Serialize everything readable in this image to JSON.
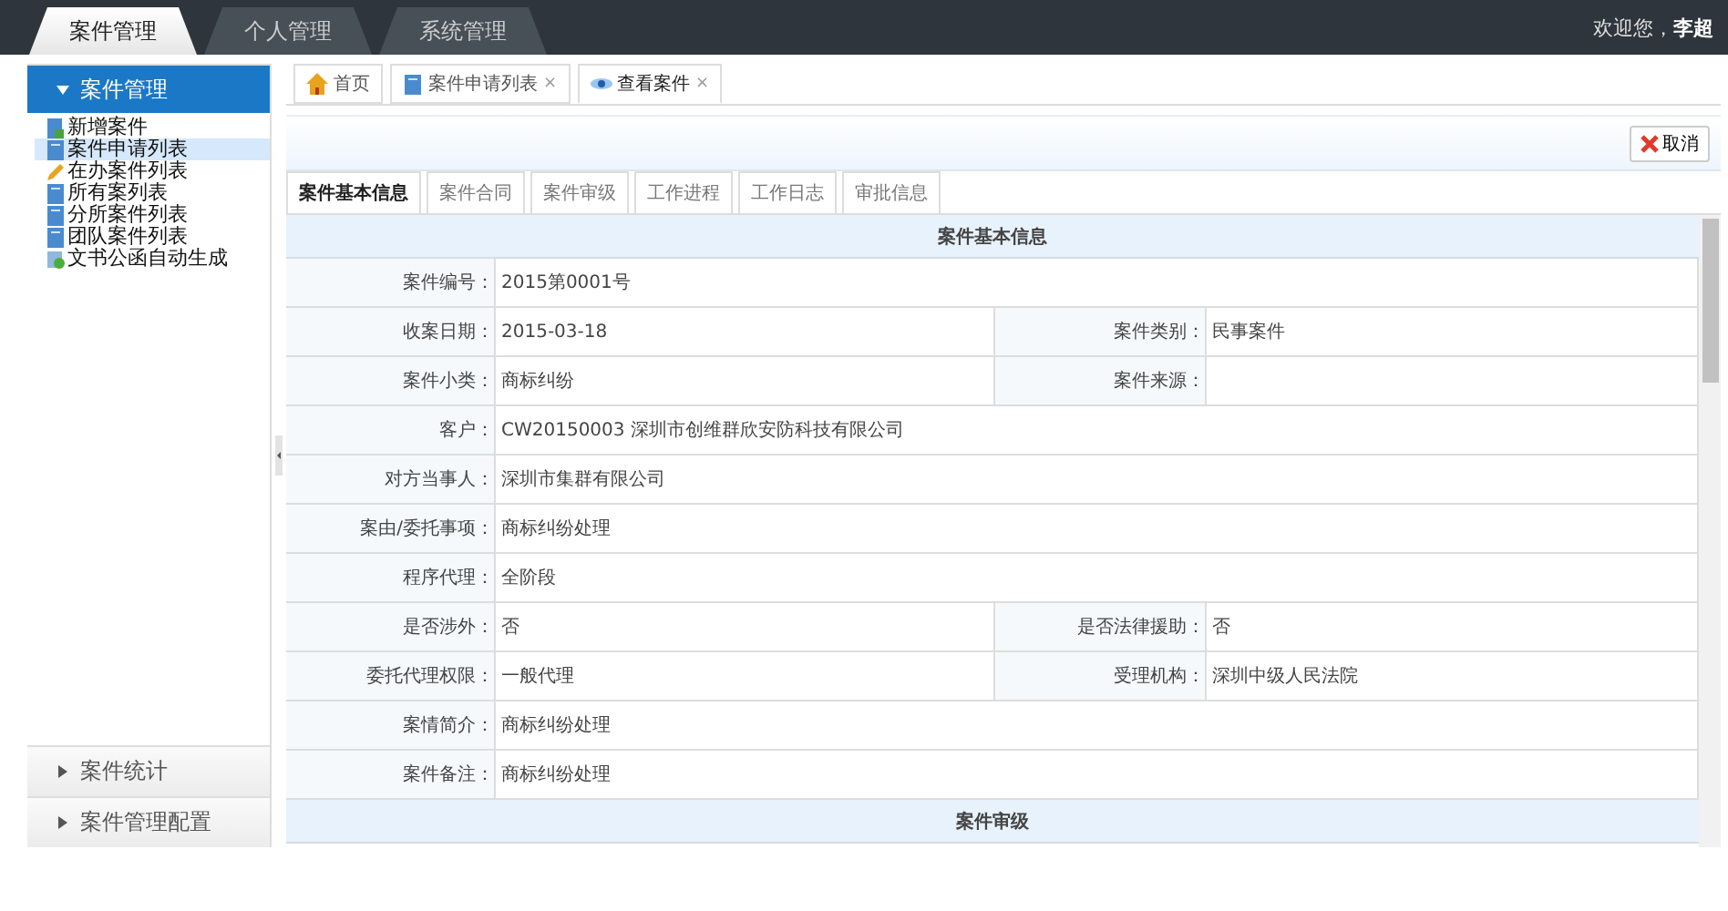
{
  "top_tabs": [
    {
      "label": "案件管理",
      "selected": true
    },
    {
      "label": "个人管理",
      "selected": false
    },
    {
      "label": "系统管理",
      "selected": false
    }
  ],
  "welcome": {
    "text": "欢迎您，",
    "user": "李超"
  },
  "sidebar": {
    "panels": [
      {
        "title": "案件管理",
        "expanded": true,
        "items": [
          {
            "label": "新增案件",
            "kind": "add",
            "selected": false
          },
          {
            "label": "案件申请列表",
            "kind": "doc",
            "selected": true
          },
          {
            "label": "在办案件列表",
            "kind": "edit",
            "selected": false
          },
          {
            "label": "所有案列表",
            "kind": "doc",
            "selected": false
          },
          {
            "label": "分所案件列表",
            "kind": "doc",
            "selected": false
          },
          {
            "label": "团队案件列表",
            "kind": "doc",
            "selected": false
          },
          {
            "label": "文书公函自动生成",
            "kind": "gen",
            "selected": false
          }
        ]
      },
      {
        "title": "案件统计",
        "expanded": false
      },
      {
        "title": "案件管理配置",
        "expanded": false
      }
    ]
  },
  "page_tabs": [
    {
      "label": "首页",
      "kind": "home",
      "selected": false
    },
    {
      "label": "案件申请列表",
      "kind": "doc",
      "close": "×",
      "selected": false
    },
    {
      "label": "查看案件",
      "kind": "eye",
      "close": "×",
      "selected": true
    }
  ],
  "cancel_button": "取消",
  "sub_tabs": [
    {
      "label": "案件基本信息",
      "selected": true
    },
    {
      "label": "案件合同",
      "selected": false
    },
    {
      "label": "案件审级",
      "selected": false
    },
    {
      "label": "工作进程",
      "selected": false
    },
    {
      "label": "工作日志",
      "selected": false
    },
    {
      "label": "审批信息",
      "selected": false
    }
  ],
  "sections": [
    {
      "title": "案件基本信息",
      "rows": [
        [
          {
            "label": "案件编号：",
            "value": "2015第0001号"
          }
        ],
        [
          {
            "label": "收案日期：",
            "value": "2015-03-18"
          },
          {
            "label": "案件类别：",
            "value": "民事案件"
          }
        ],
        [
          {
            "label": "案件小类：",
            "value": "商标纠纷"
          },
          {
            "label": "案件来源："
          }
        ],
        [
          {
            "label": "客户：",
            "value": "CW20150003 深圳市创维群欣安防科技有限公司"
          }
        ],
        [
          {
            "label": "对方当事人：",
            "value": "深圳市集群有限公司"
          }
        ],
        [
          {
            "label": "案由/委托事项：",
            "value": "商标纠纷处理"
          }
        ],
        [
          {
            "label": "程序代理：",
            "value": "全阶段"
          }
        ],
        [
          {
            "label": "是否涉外：",
            "value": "否"
          },
          {
            "label": "是否法律援助：",
            "value": "否"
          }
        ],
        [
          {
            "label": "委托代理权限：",
            "value": "一般代理"
          },
          {
            "label": "受理机构：",
            "value": "深圳中级人民法院"
          }
        ],
        [
          {
            "label": "案情简介：",
            "value": "商标纠纷处理"
          }
        ],
        [
          {
            "label": "案件备注：",
            "value": "商标纠纷处理"
          }
        ]
      ]
    },
    {
      "title": "案件审级"
    }
  ]
}
